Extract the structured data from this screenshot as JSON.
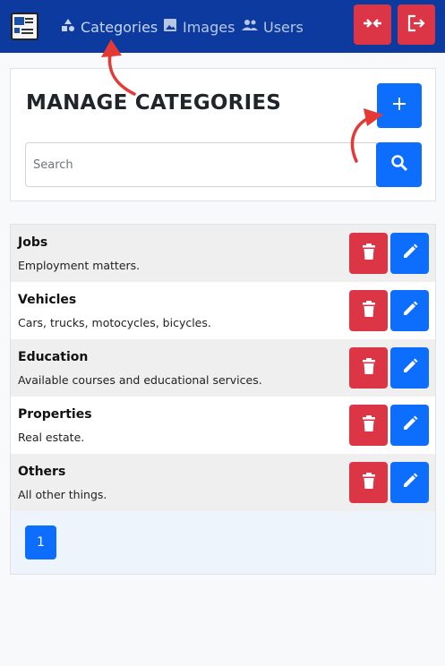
{
  "navbar": {
    "links": [
      {
        "label": "Categories",
        "icon": "shapes-icon"
      },
      {
        "label": "Images",
        "icon": "image-icon"
      },
      {
        "label": "Users",
        "icon": "users-icon"
      }
    ],
    "colors": {
      "background": "#0d3a9e",
      "danger": "#dc3545"
    }
  },
  "manage": {
    "title": "MANAGE CATEGORIES",
    "search_placeholder": "Search"
  },
  "categories": [
    {
      "name": "Jobs",
      "description": "Employment matters."
    },
    {
      "name": "Vehicles",
      "description": "Cars, trucks, motocycles, bicycles."
    },
    {
      "name": "Education",
      "description": "Available courses and educational services."
    },
    {
      "name": "Properties",
      "description": "Real estate."
    },
    {
      "name": "Others",
      "description": "All other things."
    }
  ],
  "pagination": {
    "current": "1"
  },
  "colors": {
    "primary": "#0d6efd",
    "danger": "#dc3545",
    "annotation": "#e53935"
  }
}
